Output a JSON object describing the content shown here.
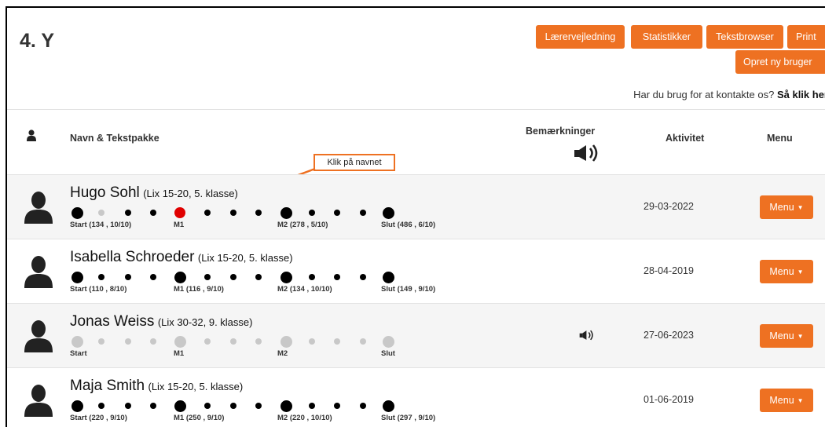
{
  "page": {
    "class_title": "4. Y",
    "buttons": {
      "teacher_guide": "Lærervejledning",
      "statistics": "Statistikker",
      "textbrowser": "Tekstbrowser",
      "print": "Print",
      "create_user": "Opret ny bruger"
    },
    "contact": {
      "text": "Har du brug for at kontakte os? ",
      "link": "Så klik her"
    },
    "columns": {
      "name": "Navn & Tekstpakke",
      "remarks": "Bemærkninger",
      "activity": "Aktivitet",
      "menu": "Menu"
    },
    "callout": "Klik på navnet",
    "menu_label": "Menu",
    "icons": {
      "user_header": "user-icon",
      "avatar": "user-silhouette-icon",
      "audio": "speaker-icon",
      "caret": "caret-down-icon"
    },
    "colors": {
      "accent": "#ee7122",
      "done": "#000000",
      "todo": "#c8c8c8",
      "current": "#e00000"
    }
  },
  "students": [
    {
      "name": "Hugo Sohl",
      "package": "(Lix 15-20, 5. klasse)",
      "date": "29-03-2022",
      "has_audio": false,
      "dots": [
        "done",
        "todo",
        "done",
        "done",
        "current",
        "done",
        "done",
        "done",
        "done",
        "done",
        "done",
        "done",
        "done"
      ],
      "labels": [
        {
          "title": "Start",
          "detail": " (134 , 10/10)"
        },
        {
          "title": "M1",
          "detail": ""
        },
        {
          "title": "M2",
          "detail": " (278 , 5/10)"
        },
        {
          "title": "Slut",
          "detail": " (486 , 6/10)"
        }
      ]
    },
    {
      "name": "Isabella Schroeder",
      "package": "(Lix 15-20, 5. klasse)",
      "date": "28-04-2019",
      "has_audio": false,
      "dots": [
        "done",
        "done",
        "done",
        "done",
        "done",
        "done",
        "done",
        "done",
        "done",
        "done",
        "done",
        "done",
        "done"
      ],
      "labels": [
        {
          "title": "Start",
          "detail": " (110 , 8/10)"
        },
        {
          "title": "M1",
          "detail": " (116 , 9/10)"
        },
        {
          "title": "M2",
          "detail": " (134 , 10/10)"
        },
        {
          "title": "Slut",
          "detail": " (149 , 9/10)"
        }
      ]
    },
    {
      "name": "Jonas Weiss",
      "package": "(Lix 30-32, 9. klasse)",
      "date": "27-06-2023",
      "has_audio": true,
      "dots": [
        "todo",
        "todo",
        "todo",
        "todo",
        "todo",
        "todo",
        "todo",
        "todo",
        "todo",
        "todo",
        "todo",
        "todo",
        "todo"
      ],
      "labels": [
        {
          "title": "Start",
          "detail": ""
        },
        {
          "title": "M1",
          "detail": ""
        },
        {
          "title": "M2",
          "detail": ""
        },
        {
          "title": "Slut",
          "detail": ""
        }
      ]
    },
    {
      "name": "Maja Smith",
      "package": "(Lix 15-20, 5. klasse)",
      "date": "01-06-2019",
      "has_audio": false,
      "dots": [
        "done",
        "done",
        "done",
        "done",
        "done",
        "done",
        "done",
        "done",
        "done",
        "done",
        "done",
        "done",
        "done"
      ],
      "labels": [
        {
          "title": "Start",
          "detail": " (220 , 9/10)"
        },
        {
          "title": "M1",
          "detail": " (250 , 9/10)"
        },
        {
          "title": "M2",
          "detail": " (220 , 10/10)"
        },
        {
          "title": "Slut",
          "detail": " (297 , 9/10)"
        }
      ]
    }
  ]
}
